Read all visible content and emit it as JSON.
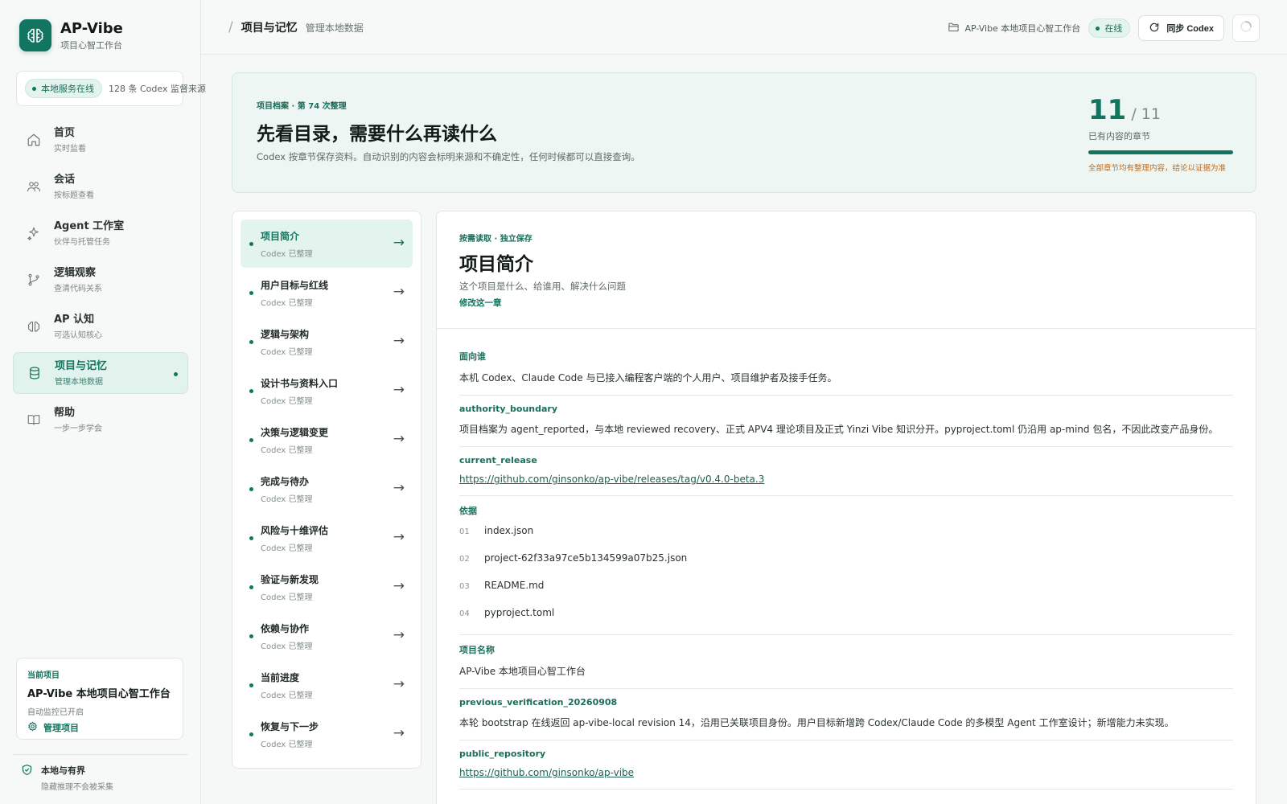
{
  "brand": {
    "title": "AP-Vibe",
    "subtitle": "项目心智工作台"
  },
  "service": {
    "status": "本地服务在线",
    "count_text": "128 条 Codex 监督来源"
  },
  "nav": [
    {
      "icon": "home-icon",
      "label": "首页",
      "sub": "实时监看",
      "active": false
    },
    {
      "icon": "people-icon",
      "label": "会话",
      "sub": "按标题查看",
      "active": false
    },
    {
      "icon": "sparkle-icon",
      "label": "Agent 工作室",
      "sub": "伙伴与托管任务",
      "active": false
    },
    {
      "icon": "branch-icon",
      "label": "逻辑观察",
      "sub": "查清代码关系",
      "active": false
    },
    {
      "icon": "brain-icon",
      "label": "AP 认知",
      "sub": "可选认知核心",
      "active": false
    },
    {
      "icon": "database-icon",
      "label": "项目与记忆",
      "sub": "管理本地数据",
      "active": true
    },
    {
      "icon": "book-icon",
      "label": "帮助",
      "sub": "一步一步学会",
      "active": false
    }
  ],
  "current_project": {
    "label": "当前项目",
    "title": "AP-Vibe 本地项目心智工作台",
    "status": "自动监控已开启",
    "manage_label": "管理项目"
  },
  "boundary": {
    "title": "本地与有界",
    "sub": "隐藏推理不会被采集"
  },
  "topbar": {
    "title": "项目与记忆",
    "subtitle": "管理本地数据",
    "workspace": "AP-Vibe 本地项目心智工作台",
    "online": "在线",
    "sync_label": "同步 Codex"
  },
  "hero": {
    "kicker": "项目档案 · 第 74 次整理",
    "title": "先看目录，需要什么再读什么",
    "desc": "Codex 按章节保存资料。自动识别的内容会标明来源和不确定性，任何时候都可以直接查询。",
    "stat_value": "11",
    "stat_total": "/ 11",
    "stat_label": "已有内容的章节",
    "progress": 1.0,
    "note": "全部章节均有整理内容，结论以证据为准"
  },
  "chapters": [
    {
      "title": "项目简介",
      "sub": "Codex 已整理",
      "active": true
    },
    {
      "title": "用户目标与红线",
      "sub": "Codex 已整理",
      "active": false
    },
    {
      "title": "逻辑与架构",
      "sub": "Codex 已整理",
      "active": false
    },
    {
      "title": "设计书与资料入口",
      "sub": "Codex 已整理",
      "active": false
    },
    {
      "title": "决策与逻辑变更",
      "sub": "Codex 已整理",
      "active": false
    },
    {
      "title": "完成与待办",
      "sub": "Codex 已整理",
      "active": false
    },
    {
      "title": "风险与十维评估",
      "sub": "Codex 已整理",
      "active": false
    },
    {
      "title": "验证与新发现",
      "sub": "Codex 已整理",
      "active": false
    },
    {
      "title": "依赖与协作",
      "sub": "Codex 已整理",
      "active": false
    },
    {
      "title": "当前进度",
      "sub": "Codex 已整理",
      "active": false
    },
    {
      "title": "恢复与下一步",
      "sub": "Codex 已整理",
      "active": false
    }
  ],
  "arrow": "→",
  "detail": {
    "kicker": "按需读取 · 独立保存",
    "title": "项目简介",
    "desc": "这个项目是什么、给谁用、解决什么问题",
    "edit_label": "修改这一章",
    "fields": {
      "audience_key": "面向谁",
      "audience_val": "本机 Codex、Claude Code 与已接入编程客户端的个人用户、项目维护者及接手任务。",
      "authority_key": "authority_boundary",
      "authority_val": "项目档案为 agent_reported，与本地 reviewed recovery、正式 APV4 理论项目及正式 Yinzi Vibe 知识分开。pyproject.toml 仍沿用 ap-mind 包名，不因此改变产品身份。",
      "release_key": "current_release",
      "release_val": "https://github.com/ginsonko/ap-vibe/releases/tag/v0.4.0-beta.3",
      "evidence_key": "依据",
      "evidence": [
        {
          "num": "01",
          "name": "index.json"
        },
        {
          "num": "02",
          "name": "project-62f33a97ce5b134599a07b25.json"
        },
        {
          "num": "03",
          "name": "README.md"
        },
        {
          "num": "04",
          "name": "pyproject.toml"
        }
      ],
      "name_key": "项目名称",
      "name_val": "AP-Vibe 本地项目心智工作台",
      "prev_key": "previous_verification_20260908",
      "prev_val": "本轮 bootstrap 在线返回 ap-vibe-local revision 14，沿用已关联项目身份。用户目标新增跨 Codex/Claude Code 的多模型 Agent 工作室设计；新增能力未实现。",
      "repo_key": "public_repository",
      "repo_val": "https://github.com/ginsonko/ap-vibe"
    }
  },
  "colors": {
    "accent": "#127560",
    "accent_light": "#e3f3ee",
    "warning": "#c06a1c"
  }
}
